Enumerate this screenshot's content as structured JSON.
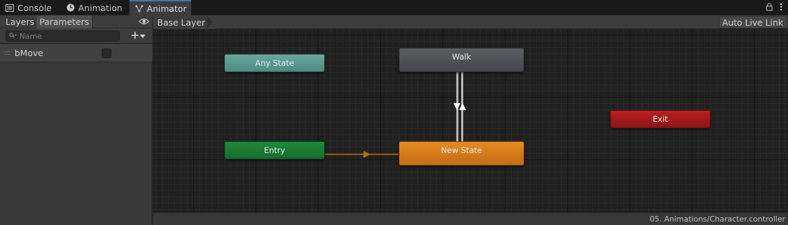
{
  "tabs": [
    {
      "label": "Console",
      "icon": "console-icon"
    },
    {
      "label": "Animation",
      "icon": "animation-clock-icon"
    },
    {
      "label": "Animator",
      "icon": "animator-icon",
      "active": true
    }
  ],
  "left_panel": {
    "tab_layers": "Layers",
    "tab_parameters": "Parameters",
    "search_placeholder": "Name",
    "parameters": [
      {
        "name": "bMove",
        "type": "bool",
        "value": false
      }
    ]
  },
  "graph": {
    "breadcrumb": "Base Layer",
    "auto_live_link": "Auto Live Link",
    "states": {
      "any_state": "Any State",
      "entry": "Entry",
      "walk": "Walk",
      "new_state": "New State",
      "exit": "Exit"
    }
  },
  "status_path": "05. Animations/Character.controller",
  "colors": {
    "any_state": "#5f9d91",
    "entry": "#1b7e35",
    "walk": "#4e5155",
    "new_state": "#d67c1a",
    "exit": "#a51b1b",
    "tab_accent": "#3a79bb"
  }
}
